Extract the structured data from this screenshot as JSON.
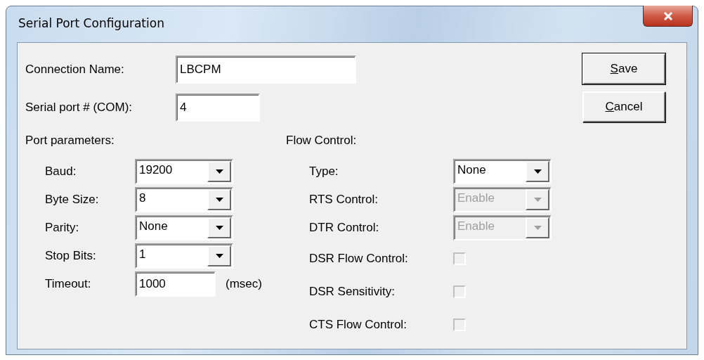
{
  "window": {
    "title": "Serial Port Configuration"
  },
  "connection_name": {
    "label": "Connection Name:",
    "value": "LBCPM"
  },
  "serial_port": {
    "label": "Serial port # (COM):",
    "value": "4"
  },
  "buttons": [
    {
      "label": "Save",
      "default": true
    },
    {
      "label": "Cancel",
      "default": false
    }
  ],
  "port_parameters": {
    "heading": "Port parameters:",
    "fields": [
      {
        "kind": "combo",
        "label": "Baud:",
        "value": "19200",
        "disabled": false
      },
      {
        "kind": "combo",
        "label": "Byte Size:",
        "value": "8",
        "disabled": false
      },
      {
        "kind": "combo",
        "label": "Parity:",
        "value": "None",
        "disabled": false
      },
      {
        "kind": "combo",
        "label": "Stop Bits:",
        "value": "1",
        "disabled": false
      },
      {
        "kind": "text",
        "label": "Timeout:",
        "value": "1000",
        "unit": "(msec)"
      }
    ]
  },
  "flow_control": {
    "heading": "Flow Control:",
    "fields": [
      {
        "kind": "combo",
        "label": "Type:",
        "value": "None",
        "disabled": false
      },
      {
        "kind": "combo",
        "label": "RTS Control:",
        "value": "Enable",
        "disabled": true
      },
      {
        "kind": "combo",
        "label": "DTR Control:",
        "value": "Enable",
        "disabled": true
      },
      {
        "kind": "checkbox",
        "label": "DSR Flow Control:",
        "checked": false,
        "disabled": true
      },
      {
        "kind": "checkbox",
        "label": "DSR Sensitivity:",
        "checked": false,
        "disabled": true
      },
      {
        "kind": "checkbox",
        "label": "CTS Flow Control:",
        "checked": false,
        "disabled": true
      }
    ]
  }
}
